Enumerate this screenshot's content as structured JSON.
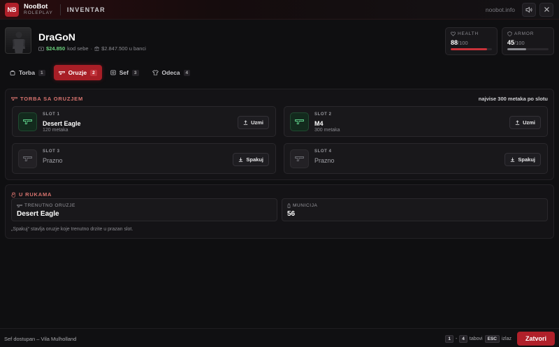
{
  "topbar": {
    "logo_text": "NB",
    "brand_name": "NooBot",
    "brand_sub": "ROLEPLAY",
    "section": "INVENTAR",
    "site": "noobot.info",
    "sound_icon": "speaker-icon",
    "close_icon": "close-icon"
  },
  "profile": {
    "name": "DraGoN",
    "cash": "$24.850",
    "cash_suffix": "kod sebe",
    "bank_sep": "·",
    "bank": "$2.847.500 u banci"
  },
  "stats": {
    "health": {
      "label": "HEALTH",
      "value": "88",
      "max": "/100",
      "level": 0.88,
      "color": "#c8323a"
    },
    "armor": {
      "label": "ARMOR",
      "value": "45",
      "max": "/100",
      "level": 0.45,
      "color": "#8a8a90"
    }
  },
  "tabs": [
    {
      "label": "Torba",
      "badge": "1"
    },
    {
      "label": "Oruzje",
      "badge": "2"
    },
    {
      "label": "Sef",
      "badge": "3"
    },
    {
      "label": "Odeca",
      "badge": "4"
    }
  ],
  "weapons_panel": {
    "title": "TORBA SA ORUZJEM",
    "note": "najvise 300 metaka po slotu",
    "slots": [
      {
        "label": "SLOT 1",
        "name": "Desert Eagle",
        "sub": "120 metaka",
        "action": "Uzmi"
      },
      {
        "label": "SLOT 2",
        "name": "M4",
        "sub": "300 metaka",
        "action": "Uzmi"
      },
      {
        "label": "SLOT 3",
        "name": "Prazno",
        "sub": "",
        "action": "Spakuj"
      },
      {
        "label": "SLOT 4",
        "name": "Prazno",
        "sub": "",
        "action": "Spakuj"
      }
    ]
  },
  "hands_panel": {
    "title": "U RUKAMA",
    "current_label": "TRENUTNO ORUZJE",
    "current_value": "Desert Eagle",
    "ammo_label": "MUNICIJA",
    "ammo_value": "56",
    "hint": "„Spakuj“ stavlja oruzje koje trenutno drzite u prazan slot."
  },
  "footer": {
    "status": "Sef dostupan – Vila Mulholland",
    "key_from": "1",
    "key_dash": "-",
    "key_to": "4",
    "tabs_text": "tabovi",
    "esc_key": "ESC",
    "exit_text": "izlaz",
    "close_label": "Zatvori"
  },
  "colors": {
    "accent": "#b0202a",
    "cash": "#6cd17e",
    "panel_title": "#d9746f"
  }
}
